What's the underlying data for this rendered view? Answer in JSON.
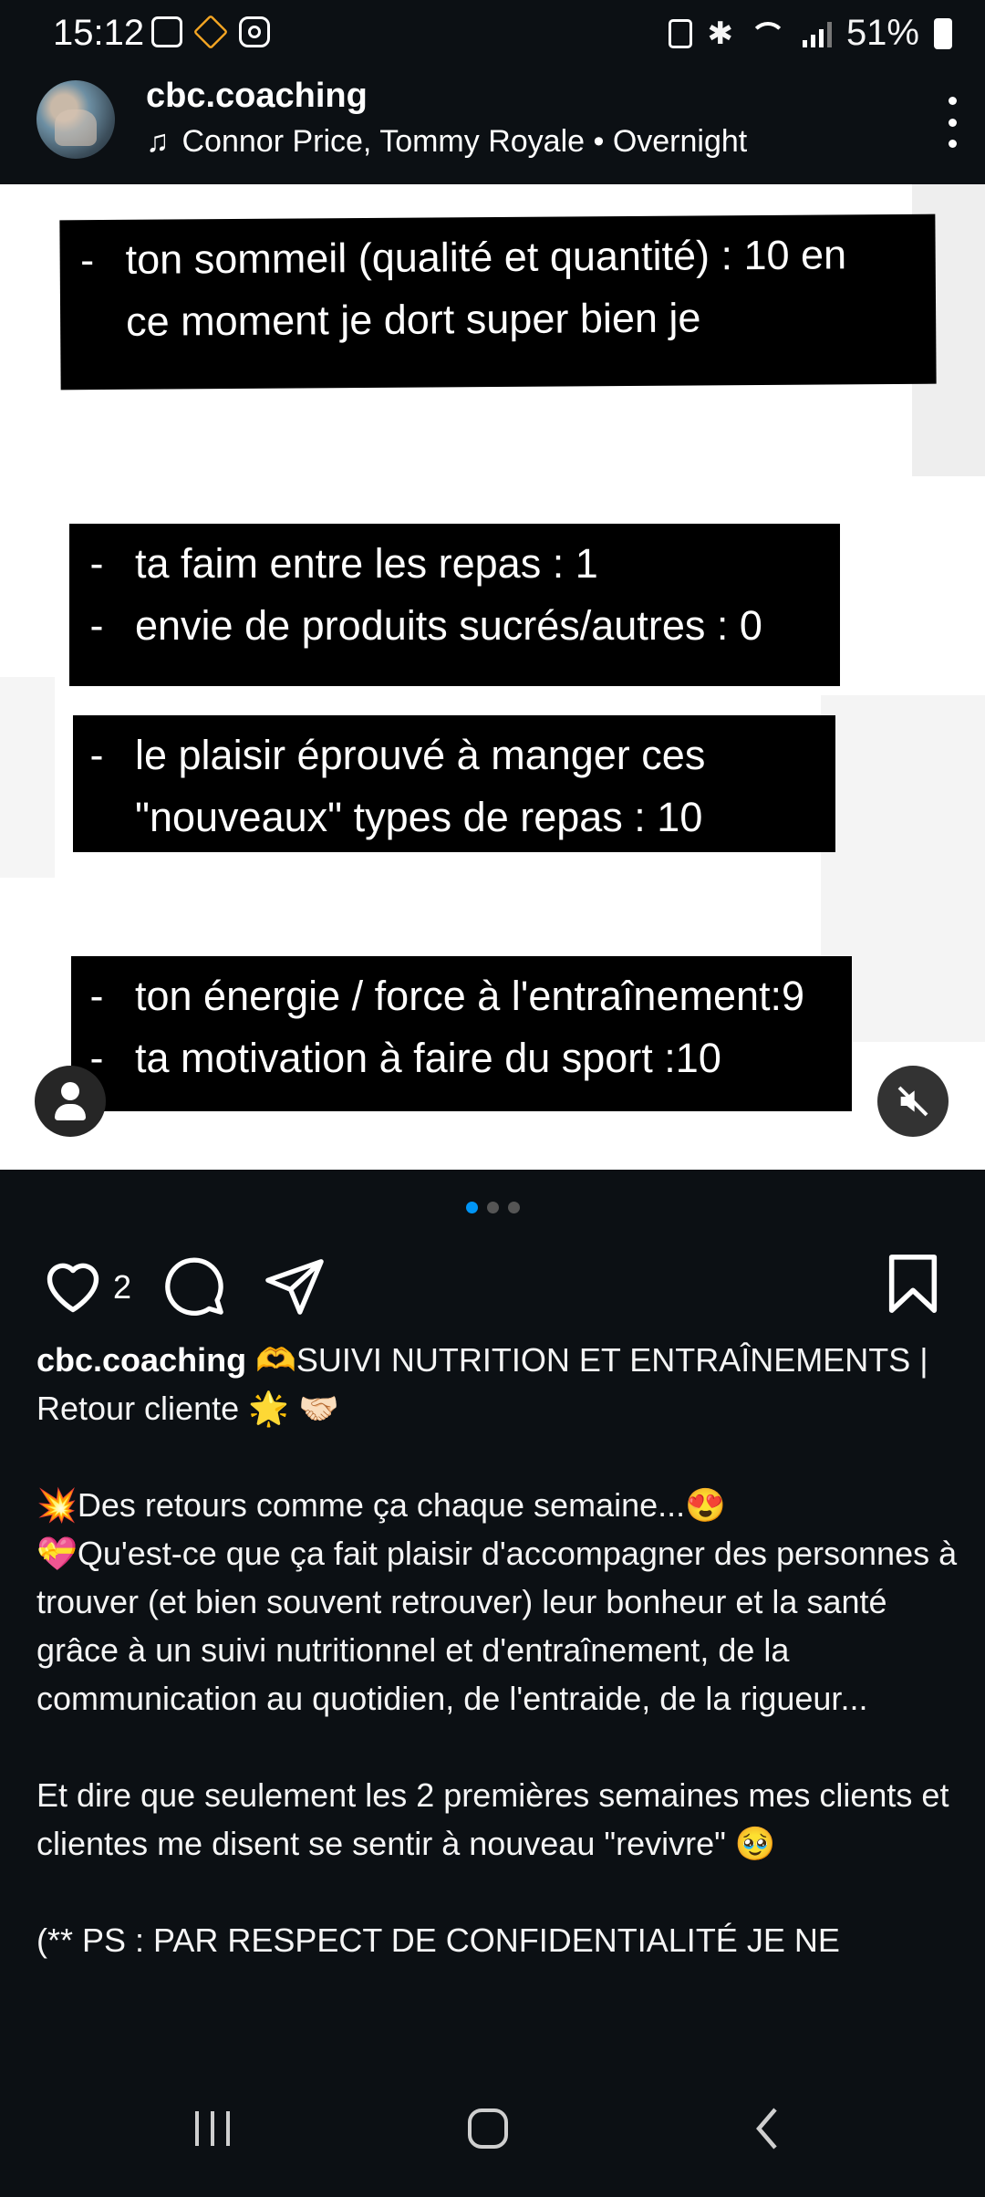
{
  "status_bar": {
    "time": "15:12",
    "battery": "51%",
    "left_icons": [
      "gallery-icon",
      "app-icon",
      "instagram-icon"
    ],
    "right_icons": [
      "nfc-icon",
      "bluetooth-icon",
      "wifi-icon",
      "signal-icon",
      "battery-icon"
    ]
  },
  "header": {
    "username": "cbc.coaching",
    "music": "Connor Price, Tommy Royale • Overnight"
  },
  "media": {
    "blocks": [
      {
        "lines": [
          "ton sommeil (qualité et quantité) : 10 en",
          "ce moment je dort super bien je"
        ]
      },
      {
        "lines": [
          "ta faim entre les repas : 1",
          "envie de produits sucrés/autres : 0"
        ]
      },
      {
        "lines": [
          "le plaisir éprouvé à manger ces",
          "\"nouveaux\" types de repas : 10"
        ]
      },
      {
        "lines": [
          "ton énergie / force à l'entraînement:9",
          "ta motivation à faire du sport :10"
        ]
      }
    ]
  },
  "carousel": {
    "count": 3,
    "active": 0
  },
  "actions": {
    "like_count": "2"
  },
  "caption": {
    "username": "cbc.coaching",
    "title": "🫶SUIVI NUTRITION ET ENTRAÎNEMENTS | Retour cliente 🌟 🤝🏻",
    "p1": "💥Des retours comme ça chaque semaine...😍",
    "p2": "💝Qu'est-ce que ça fait plaisir d'accompagner des personnes à trouver (et bien souvent retrouver) leur bonheur et la santé grâce à un suivi nutritionnel et d'entraînement, de la communication au quotidien, de l'entraide, de la rigueur...",
    "p3": "Et dire que seulement les 2 premières semaines mes clients et clientes me disent se sentir à nouveau \"revivre\" 🥹",
    "p4": "(** PS : PAR RESPECT DE CONFIDENTIALITÉ JE NE"
  },
  "colors": {
    "background": "#0c1014",
    "accent": "#0095f6"
  }
}
